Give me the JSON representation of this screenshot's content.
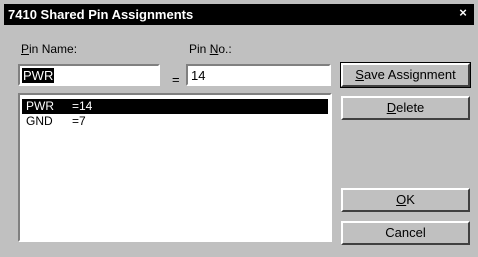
{
  "window": {
    "title": "7410 Shared Pin Assignments",
    "close_glyph": "×"
  },
  "labels": {
    "pin_name_prefix": "P",
    "pin_name_rest": "in Name:",
    "pin_no_prefix": "Pin ",
    "pin_no_underlined": "N",
    "pin_no_rest": "o.:",
    "equals": "="
  },
  "fields": {
    "pin_name_value": "PWR",
    "pin_no_value": "14"
  },
  "assignments": [
    {
      "name": "PWR",
      "pin": "=14",
      "selected": true
    },
    {
      "name": "GND",
      "pin": "=7",
      "selected": false
    }
  ],
  "buttons": {
    "save_prefix": "S",
    "save_rest": "ave Assignment",
    "delete_prefix": "D",
    "delete_rest": "elete",
    "ok_prefix": "O",
    "ok_rest": "K",
    "cancel": "Cancel"
  }
}
